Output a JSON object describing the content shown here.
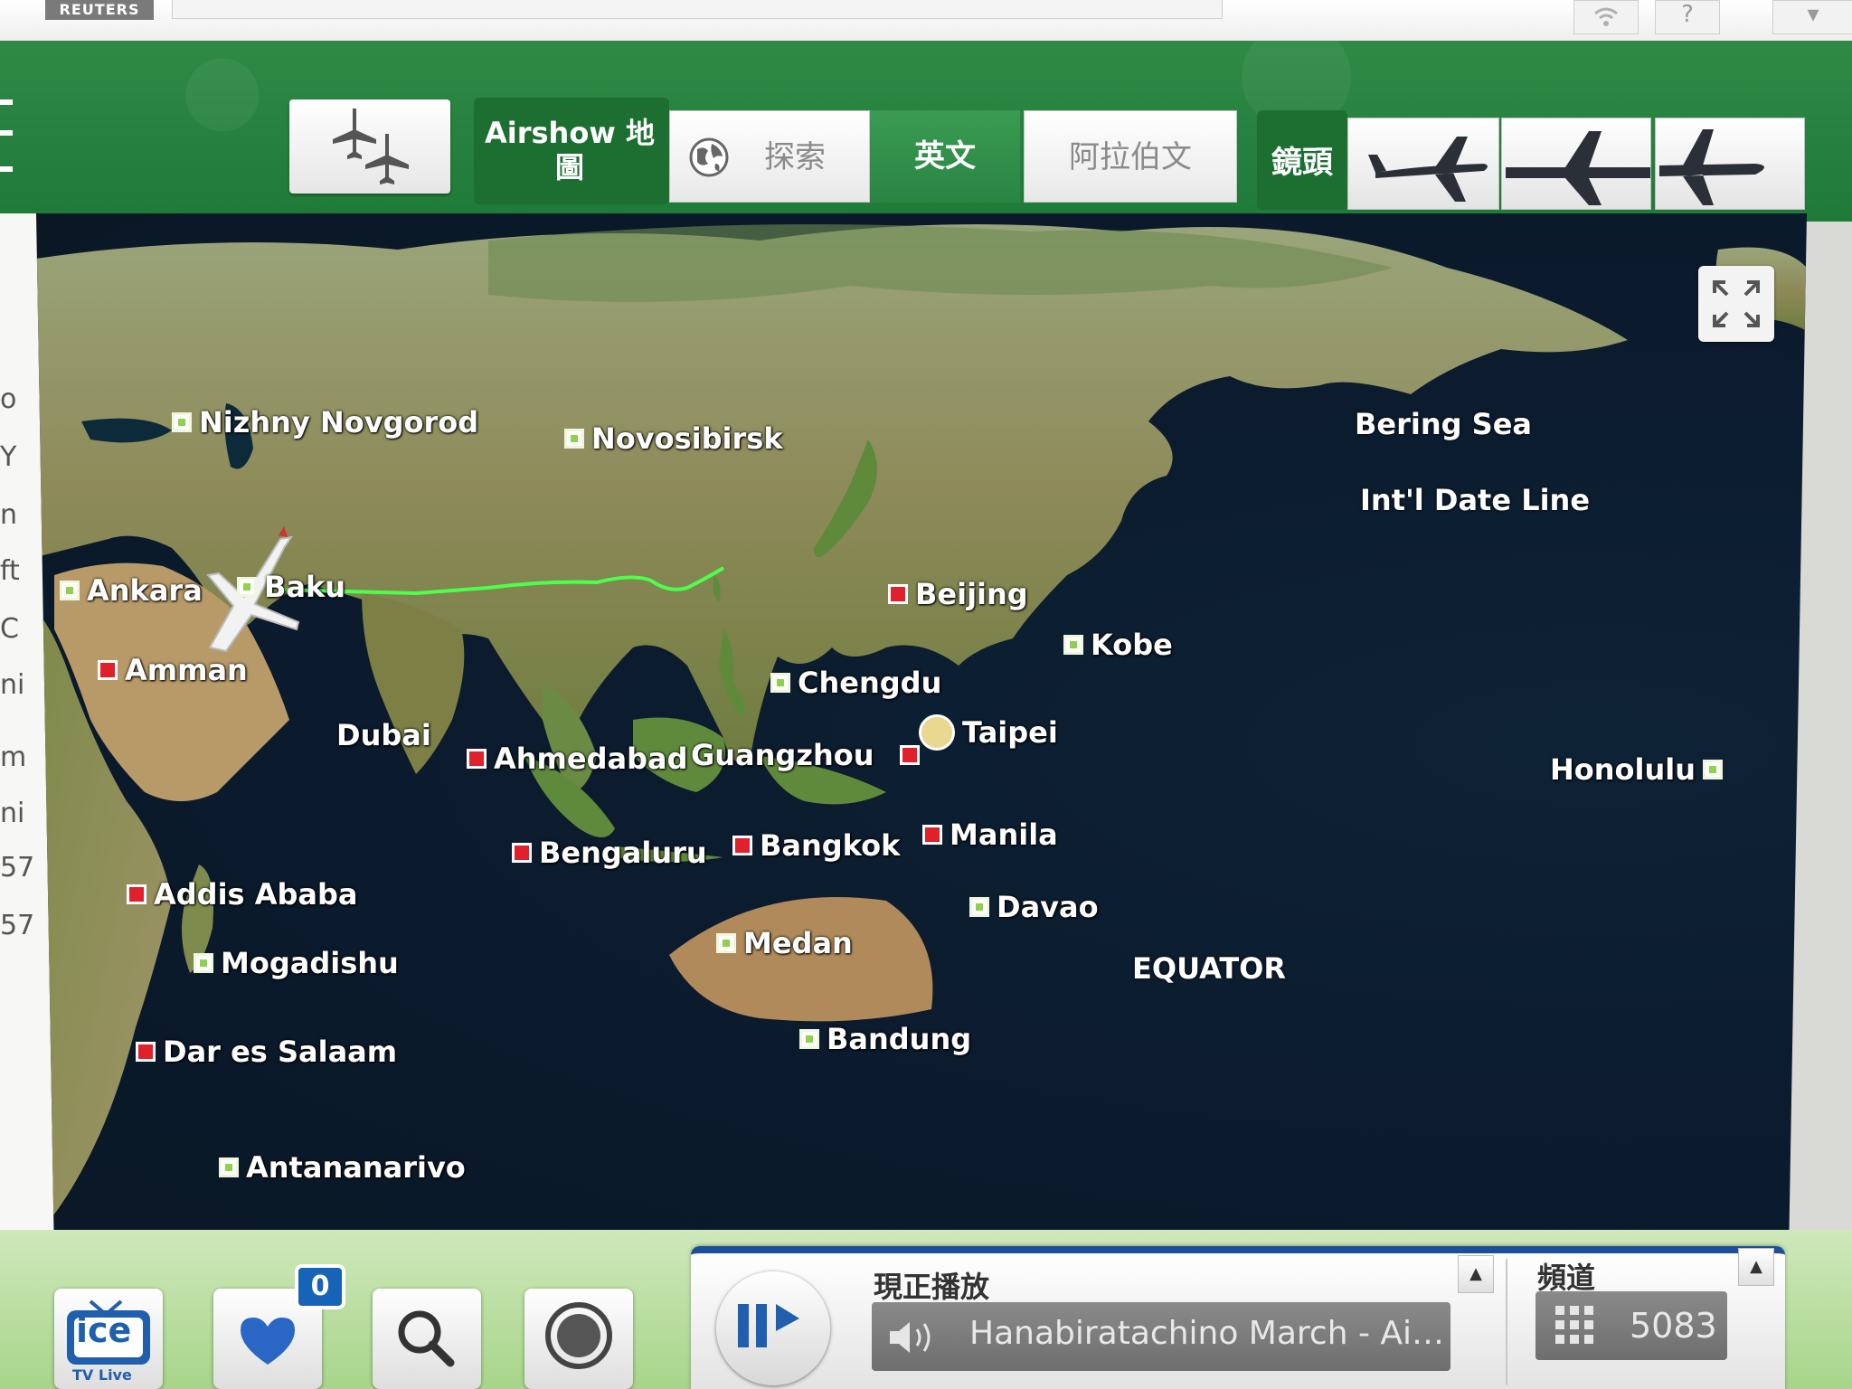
{
  "top": {
    "brand": "REUTERS"
  },
  "toolbar": {
    "airshow_label": "Airshow 地圖",
    "lang_tabs": [
      "探索",
      "英文",
      "阿拉伯文"
    ],
    "camera_label": "鏡頭"
  },
  "sidebar": {
    "chars": [
      "o",
      "Y",
      "n",
      "ft",
      "C",
      "ni",
      "m",
      "ni",
      "57",
      "57"
    ]
  },
  "map": {
    "cities": [
      {
        "name": "Nizhny Novgorod",
        "marker": "green"
      },
      {
        "name": "Novosibirsk",
        "marker": "green"
      },
      {
        "name": "Ankara",
        "marker": "green"
      },
      {
        "name": "Baku",
        "marker": "green"
      },
      {
        "name": "Amman",
        "marker": "red"
      },
      {
        "name": "Beijing",
        "marker": "red"
      },
      {
        "name": "Kobe",
        "marker": "green"
      },
      {
        "name": "Chengdu",
        "marker": "green"
      },
      {
        "name": "Dubai",
        "marker": "plane"
      },
      {
        "name": "Ahmedabad",
        "marker": "red"
      },
      {
        "name": "Guangzhou",
        "marker": "red"
      },
      {
        "name": "Taipei",
        "marker": "origin"
      },
      {
        "name": "Honolulu",
        "marker": "green"
      },
      {
        "name": "Bengaluru",
        "marker": "red"
      },
      {
        "name": "Bangkok",
        "marker": "red"
      },
      {
        "name": "Manila",
        "marker": "red"
      },
      {
        "name": "Addis Ababa",
        "marker": "red"
      },
      {
        "name": "Davao",
        "marker": "green"
      },
      {
        "name": "Medan",
        "marker": "green"
      },
      {
        "name": "Mogadishu",
        "marker": "green"
      },
      {
        "name": "Dar es Salaam",
        "marker": "red"
      },
      {
        "name": "Bandung",
        "marker": "green"
      },
      {
        "name": "Antananarivo",
        "marker": "green"
      }
    ],
    "regions": {
      "bering_sea": "Bering Sea",
      "date_line": "Int'l Date Line",
      "equator": "EQUATOR"
    }
  },
  "bottom": {
    "favorites_count": "0",
    "now_playing_label": "現正播放",
    "track": "Hanabiratachino March - Ai…",
    "channel_label": "頻道",
    "channel_number": "5083",
    "ice_label": "ice",
    "ice_sub": "TV Live"
  },
  "colors": {
    "green_ui": "#2a8443",
    "route": "#4dff4d",
    "dark_blue": "#1b4f9a"
  }
}
